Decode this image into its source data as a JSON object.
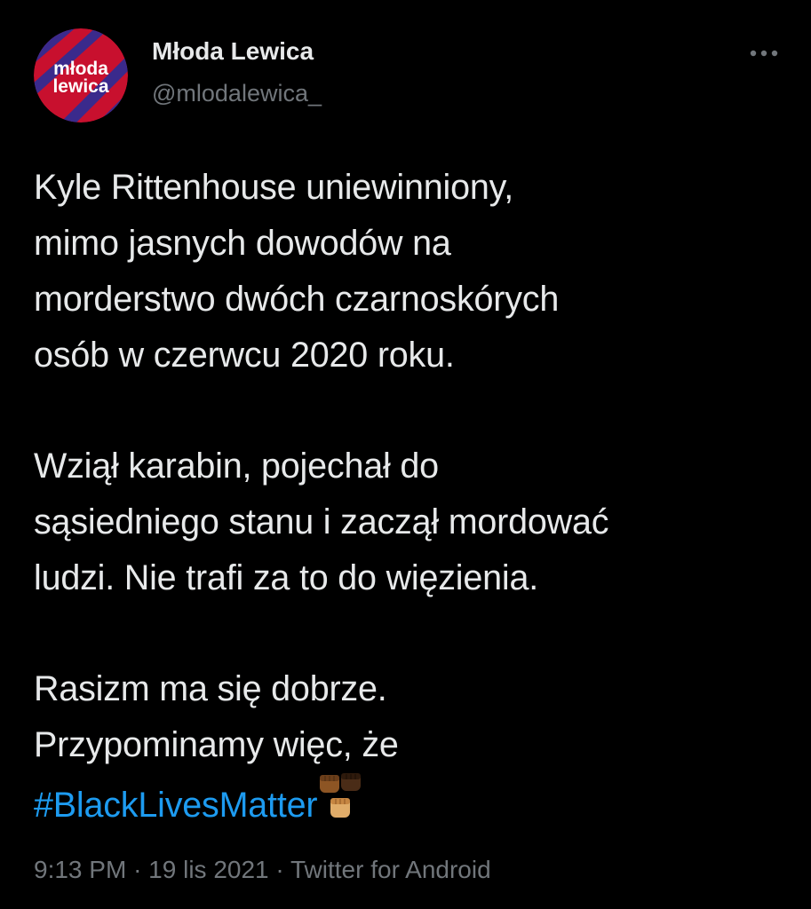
{
  "account": {
    "display_name": "Młoda Lewica",
    "handle": "@mlodalewica_",
    "avatar_logo_text_line1": "młoda",
    "avatar_logo_text_line2": "lewica",
    "avatar_colors": {
      "background": "#c8102e",
      "stripes": "#3a2a8c",
      "text": "#ffffff"
    }
  },
  "menu": {
    "icon": "more-horizontal-icon"
  },
  "tweet": {
    "paragraph1": [
      "Kyle Rittenhouse uniewinniony,",
      "mimo jasnych dowodów na",
      "morderstwo dwóch czarnoskórych",
      "osób w czerwcu 2020 roku."
    ],
    "paragraph2": [
      "Wziął karabin, pojechał do",
      "sąsiedniego stanu i zaczął mordować",
      "ludzi. Nie trafi za to do więzienia."
    ],
    "paragraph3": [
      "Rasizm ma się dobrze.",
      "Przypominamy więc, że"
    ],
    "hashtag": "#BlackLivesMatter",
    "emoji": "raised-fists-icon"
  },
  "meta": {
    "time": "9:13 PM",
    "separator": "·",
    "date": "19 lis 2021",
    "source": "Twitter for Android"
  },
  "colors": {
    "background": "#000000",
    "text": "#e7e9ea",
    "secondary": "#71767b",
    "link": "#1d9bf0"
  }
}
